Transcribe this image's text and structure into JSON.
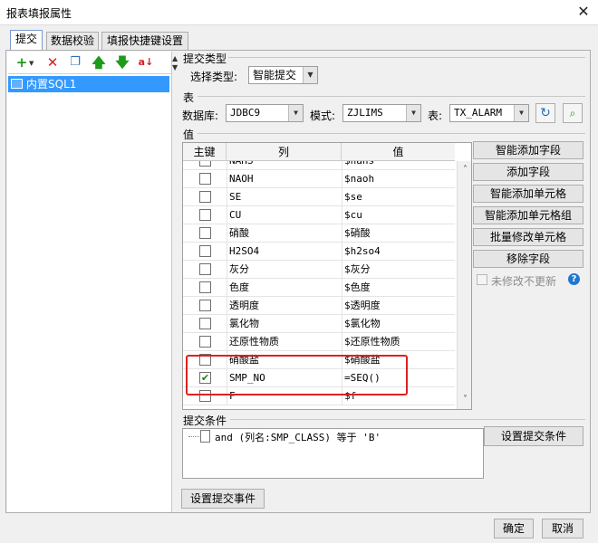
{
  "window": {
    "title": "报表填报属性",
    "close_glyph": "✕"
  },
  "tabs": [
    {
      "label": "提交",
      "active": true
    },
    {
      "label": "数据校验",
      "active": false
    },
    {
      "label": "填报快捷键设置",
      "active": false
    }
  ],
  "left_toolbar": {
    "add_icon": "add-icon",
    "delete_icon": "delete-icon",
    "copy_icon": "copy-icon",
    "up_icon": "move-up-icon",
    "down_icon": "move-down-icon",
    "sort_icon": "sort-icon"
  },
  "tree": {
    "items": [
      {
        "label": "内置SQL1",
        "selected": true
      }
    ]
  },
  "submit_type": {
    "section": "提交类型",
    "label": "选择类型:",
    "value": "智能提交"
  },
  "table_section": {
    "section": "表",
    "db_label": "数据库:",
    "db_value": "JDBC9",
    "schema_label": "模式:",
    "schema_value": "ZJLIMS",
    "table_label": "表:",
    "table_value": "TX_ALARM"
  },
  "values_section": {
    "section": "值",
    "headers": {
      "key": "主键",
      "column": "列",
      "value": "值"
    },
    "rows": [
      {
        "checked": false,
        "column": "NAHS",
        "value": "$nahs"
      },
      {
        "checked": false,
        "column": "NAOH",
        "value": "$naoh"
      },
      {
        "checked": false,
        "column": "SE",
        "value": "$se"
      },
      {
        "checked": false,
        "column": "CU",
        "value": "$cu"
      },
      {
        "checked": false,
        "column": "硝酸",
        "value": "$硝酸"
      },
      {
        "checked": false,
        "column": "H2SO4",
        "value": "$h2so4"
      },
      {
        "checked": false,
        "column": "灰分",
        "value": "$灰分"
      },
      {
        "checked": false,
        "column": "色度",
        "value": "$色度"
      },
      {
        "checked": false,
        "column": "透明度",
        "value": "$透明度"
      },
      {
        "checked": false,
        "column": "氯化物",
        "value": "$氯化物"
      },
      {
        "checked": false,
        "column": "还原性物质",
        "value": "$还原性物质"
      },
      {
        "checked": false,
        "column": "硝酸盐",
        "value": "$硝酸盐"
      },
      {
        "checked": true,
        "column": "SMP_NO",
        "value": "=SEQ()"
      },
      {
        "checked": false,
        "column": "F",
        "value": "$f"
      }
    ],
    "scroll_up": "˄",
    "scroll_down": "˅"
  },
  "right_buttons": {
    "smart_add_field": "智能添加字段",
    "add_field": "添加字段",
    "smart_add_cell": "智能添加单元格",
    "smart_add_cell_group": "智能添加单元格组",
    "batch_modify_cell": "批量修改单元格",
    "remove_field": "移除字段",
    "unchanged_no_update": "未修改不更新",
    "help": "?"
  },
  "condition_section": {
    "section": "提交条件",
    "condition_text": "and (列名:SMP_CLASS) 等于 'B'",
    "set_condition_button": "设置提交条件"
  },
  "bottom": {
    "set_event_button": "设置提交事件",
    "ok_button": "确定",
    "cancel_button": "取消"
  },
  "colors": {
    "selection": "#3399ff",
    "highlight_box": "#e02020",
    "arrow_green": "#1c9b1c",
    "delete_red": "#d42020"
  }
}
